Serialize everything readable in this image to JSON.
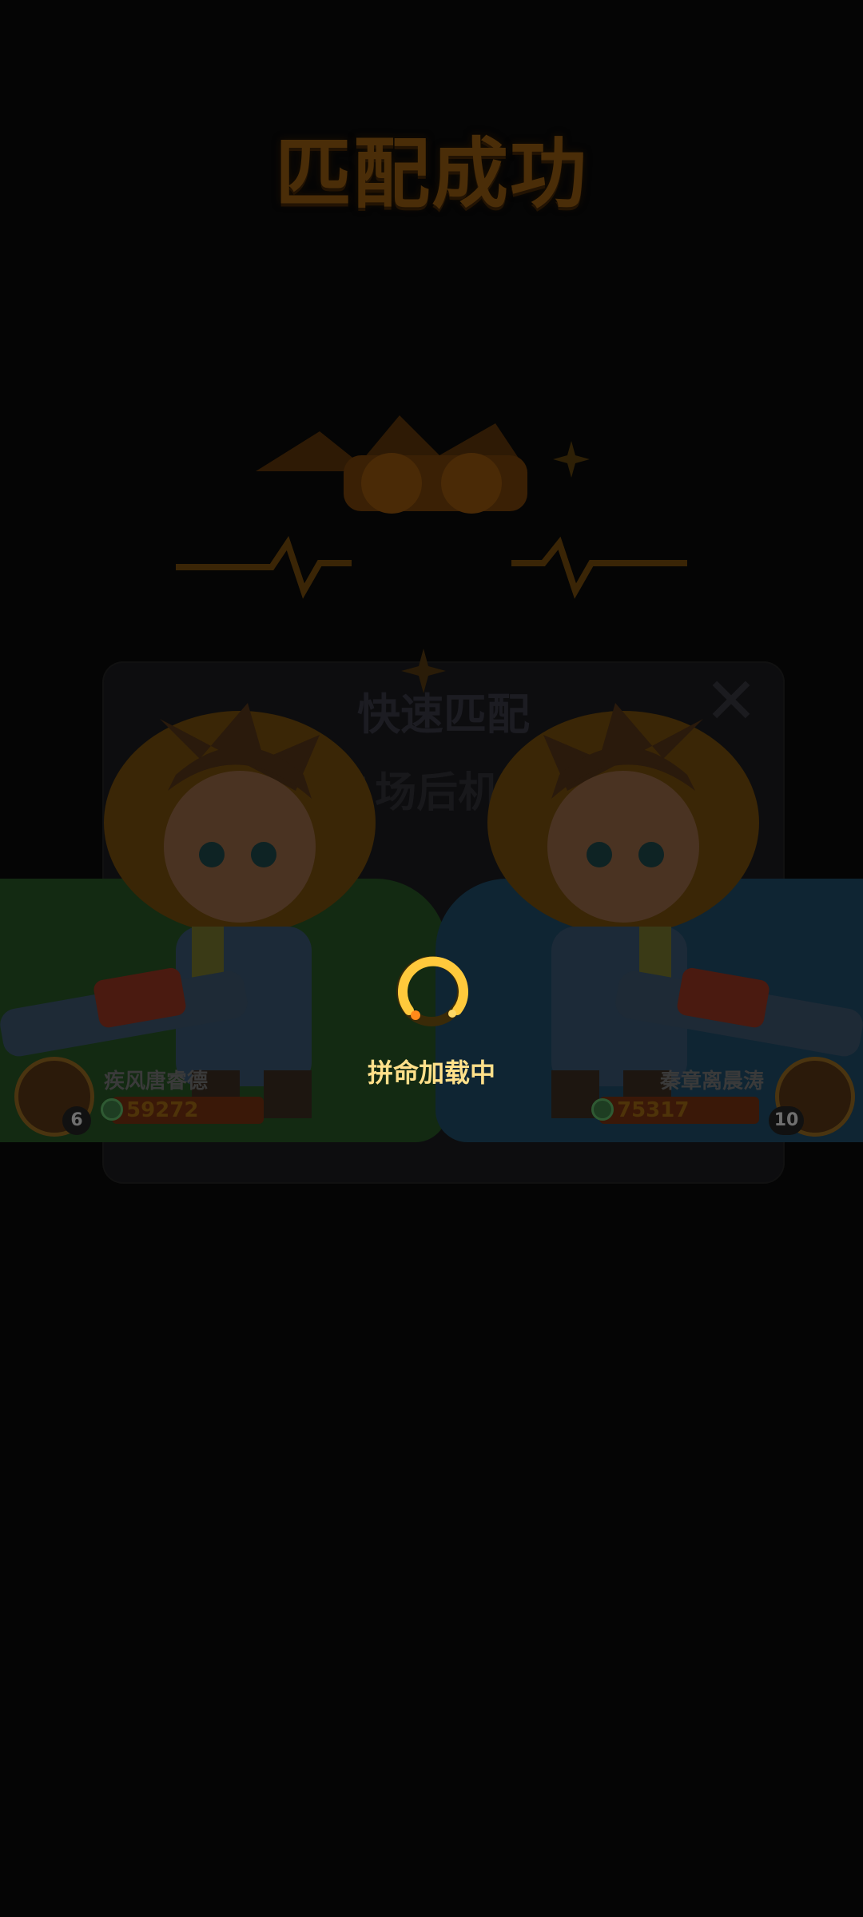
{
  "popup": {
    "title": "快速匹配",
    "subtitle": "1场后机会"
  },
  "banner": {
    "title": "匹配成功"
  },
  "players": {
    "left": {
      "name": "疾风唐睿德",
      "level": "6",
      "score": "59272"
    },
    "right": {
      "name": "秦章离晨涛",
      "level": "10",
      "score": "75317"
    }
  },
  "loading": {
    "text": "拼命加载中"
  },
  "colors": {
    "loader_accent": "#ffc93c",
    "loading_text": "#ffe08a",
    "left_team": "#132a12",
    "right_team": "#0f2533"
  },
  "icons": [
    "close-icon",
    "gem-icon",
    "avatar-icon",
    "spark-icon"
  ]
}
